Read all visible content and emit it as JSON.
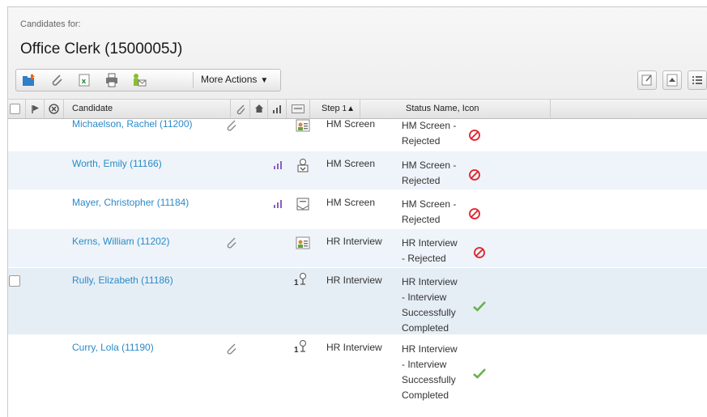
{
  "header": {
    "candidates_for": "Candidates for:",
    "job_title": "Office Clerk (1500005J)"
  },
  "toolbar": {
    "more_actions": "More Actions"
  },
  "columns": {
    "candidate": "Candidate",
    "step": "Step",
    "step_sort": "1",
    "status": "Status Name, Icon"
  },
  "rows": [
    {
      "name": "Michaelson, Rachel (11200)",
      "step": "HM Screen",
      "status": "HM Screen - Rejected",
      "status_icon": "rejected-icon",
      "attachment": true,
      "ranking": false,
      "doc_icon": "profile-card-icon"
    },
    {
      "name": "Worth, Emily (11166)",
      "step": "HM Screen",
      "status": "HM Screen - Rejected",
      "status_icon": "rejected-icon",
      "attachment": false,
      "ranking": true,
      "doc_icon": "user-download-icon"
    },
    {
      "name": "Mayer, Christopher (11184)",
      "step": "HM Screen",
      "status": "HM Screen - Rejected",
      "status_icon": "rejected-icon",
      "attachment": false,
      "ranking": true,
      "doc_icon": "form-icon"
    },
    {
      "name": "Kerns, William (11202)",
      "step": "HR Interview",
      "status": "HR Interview - Rejected",
      "status_icon": "rejected-icon",
      "attachment": true,
      "ranking": false,
      "doc_icon": "profile-card-icon"
    },
    {
      "name": "Rully, Elizabeth (11186)",
      "step": "HR Interview",
      "status": "HR Interview - Interview Successfully Completed",
      "status_icon": "checkmark-icon",
      "attachment": false,
      "ranking": false,
      "doc_icon": "interview-icon",
      "interview_count": "1"
    },
    {
      "name": "Curry, Lola (11190)",
      "step": "HR Interview",
      "status": "HR Interview - Interview Successfully Completed",
      "status_icon": "checkmark-icon",
      "attachment": true,
      "ranking": false,
      "doc_icon": "interview-icon",
      "interview_count": "1"
    }
  ],
  "colors": {
    "link": "#2a8ac8",
    "rejected": "#e0202a",
    "success": "#6ab04c",
    "ranking": "#8a5fc0"
  }
}
